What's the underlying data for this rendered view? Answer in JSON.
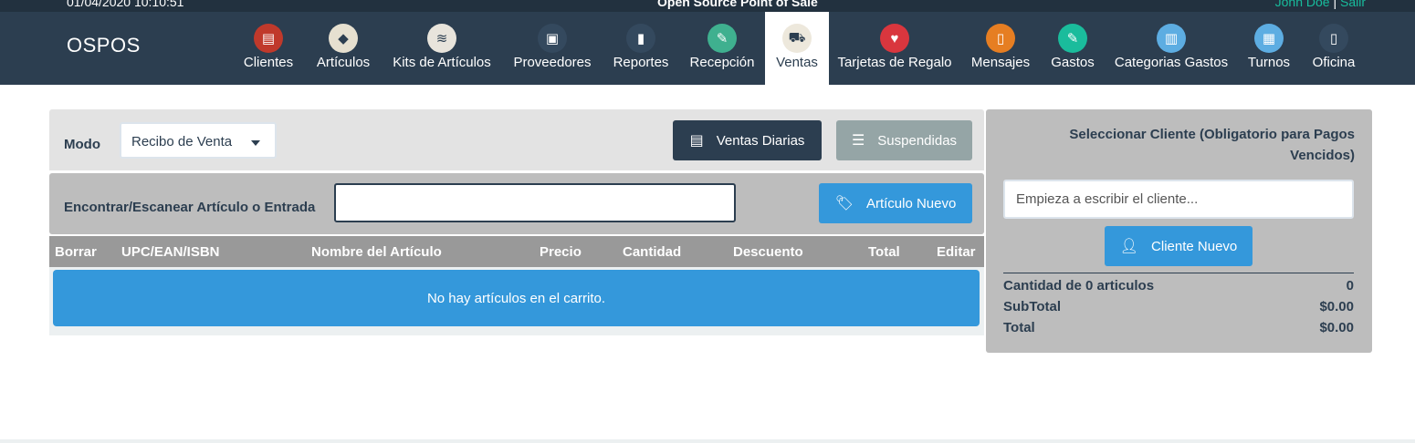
{
  "topbar": {
    "datetime": "01/04/2020 10:10:51",
    "center_title": "Open Source Point of Sale",
    "user": "John Doe",
    "separator": "|",
    "logout": "Salir"
  },
  "brand": "OSPOS",
  "nav": [
    {
      "label": "Clientes",
      "icon": "address-book-icon",
      "glyph": "▤",
      "color": "#c0392b"
    },
    {
      "label": "Artículos",
      "icon": "tag-icon",
      "glyph": "◆",
      "color": "#e6e0d0"
    },
    {
      "label": "Kits de Artículos",
      "icon": "layers-icon",
      "glyph": "≋",
      "color": "#e8e4dc"
    },
    {
      "label": "Proveedores",
      "icon": "briefcase-icon",
      "glyph": "▣",
      "color": "#34495e"
    },
    {
      "label": "Reportes",
      "icon": "bar-chart-icon",
      "glyph": "▮",
      "color": "#34495e"
    },
    {
      "label": "Recepción",
      "icon": "receiving-icon",
      "glyph": "✎",
      "color": "#3fb08f"
    },
    {
      "label": "Ventas",
      "icon": "shopping-cart-icon",
      "glyph": "⛟",
      "color": "#ede8dc",
      "active": true
    },
    {
      "label": "Tarjetas de Regalo",
      "icon": "heart-icon",
      "glyph": "♥",
      "color": "#d9363e"
    },
    {
      "label": "Mensajes",
      "icon": "phone-icon",
      "glyph": "▯",
      "color": "#e67e22"
    },
    {
      "label": "Gastos",
      "icon": "edit-icon",
      "glyph": "✎",
      "color": "#1abc9c"
    },
    {
      "label": "Categorias Gastos",
      "icon": "clipboard-icon",
      "glyph": "▥",
      "color": "#5dade2"
    },
    {
      "label": "Turnos",
      "icon": "books-icon",
      "glyph": "▦",
      "color": "#5dade2"
    },
    {
      "label": "Oficina",
      "icon": "door-icon",
      "glyph": "▯",
      "color": "#34495e"
    }
  ],
  "register": {
    "mode_label": "Modo",
    "mode_value": "Recibo de Venta",
    "daily_sales_label": "Ventas Diarias",
    "suspended_label": "Suspendidas",
    "find_label": "Encontrar/Escanear Artículo o Entrada",
    "find_value": "",
    "new_item_label": "Artículo Nuevo",
    "columns": [
      "Borrar",
      "UPC/EAN/ISBN",
      "Nombre del Artículo",
      "Precio",
      "Cantidad",
      "Descuento",
      "Total",
      "Editar"
    ],
    "empty_message": "No hay artículos en el carrito."
  },
  "sidebar": {
    "select_customer_label": "Seleccionar Cliente (Obligatorio para Pagos Vencidos)",
    "customer_placeholder": "Empieza a escribir el cliente...",
    "new_customer_label": "Cliente Nuevo",
    "summary": [
      {
        "label": "Cantidad de 0 articulos",
        "value": "0"
      },
      {
        "label": "SubTotal",
        "value": "$0.00"
      },
      {
        "label": "Total",
        "value": "$0.00"
      }
    ]
  }
}
